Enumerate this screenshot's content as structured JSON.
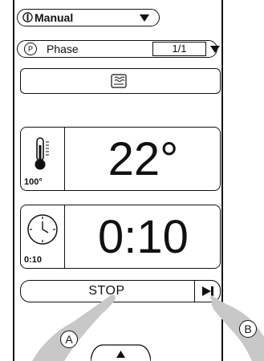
{
  "mode": {
    "label": "Manual",
    "icon": "mode-dial-icon"
  },
  "phase": {
    "icon_letter": "P",
    "label": "Phase",
    "value": "1/1"
  },
  "steam": {
    "icon": "steam-tray-icon"
  },
  "temperature": {
    "value": "22°",
    "setpoint": "100°",
    "icon": "thermometer-icon"
  },
  "time": {
    "value": "0:10",
    "setpoint": "0:10",
    "icon": "clock-icon"
  },
  "stop": {
    "label": "STOP"
  },
  "next": {
    "icon": "skip-next-icon"
  },
  "callouts": {
    "a": "A",
    "b": "B"
  }
}
